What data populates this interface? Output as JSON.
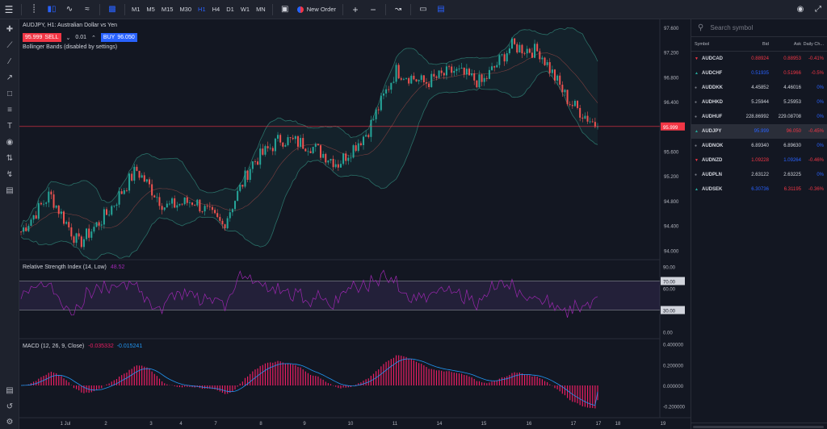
{
  "toolbar": {
    "timeframes": [
      "M1",
      "M5",
      "M15",
      "M30",
      "H1",
      "H4",
      "D1",
      "W1",
      "MN"
    ],
    "active_timeframe": "H1",
    "new_order": "New Order"
  },
  "chart": {
    "symbol_title": "AUDJPY, H1: Australian Dollar vs Yen",
    "sell_price": "95.999",
    "sell_label": "SELL",
    "quantity": "0.01",
    "buy_label": "BUY",
    "buy_price": "96.050",
    "bb_legend": "Bollinger Bands (disabled by settings)",
    "rsi_legend": "Relative Strength Index (14, Low)",
    "rsi_value": "48.52",
    "macd_legend": "MACD (12, 26, 9, Close)",
    "macd_value1": "-0.035332",
    "macd_value2": "-0.015241",
    "current_price_label": "95.999",
    "price_axis": [
      "97.600",
      "97.200",
      "96.800",
      "96.400",
      "96.000",
      "95.600",
      "95.200",
      "94.800",
      "94.400",
      "94.000"
    ],
    "rsi_axis": [
      "90.00",
      "70.00",
      "60.00",
      "30.00",
      "0.00"
    ],
    "macd_axis": [
      "0.400000",
      "0.200000",
      "0.000000",
      "-0.200000"
    ],
    "date_axis": [
      "1 Jul",
      "2",
      "3",
      "4",
      "7",
      "8",
      "9",
      "10",
      "11",
      "14",
      "15",
      "16",
      "17",
      "17",
      "18",
      "19"
    ],
    "colors": {
      "up": "#26a69a",
      "down": "#ef5350",
      "rsi": "#9c27b0",
      "macd_hist": "#e91e63",
      "macd_line": "#2196f3",
      "price_line": "#f23645"
    }
  },
  "chart_data": {
    "type": "candlestick",
    "title": "AUDJPY, H1: Australian Dollar vs Yen",
    "ylim": [
      93.9,
      97.65
    ],
    "x_dates": [
      "1 Jul",
      "2",
      "3",
      "4",
      "7",
      "8",
      "9",
      "10",
      "11",
      "14",
      "15",
      "16",
      "17",
      "17"
    ],
    "close_path_points": [
      {
        "date": "1 Jul",
        "value": 94.3
      },
      {
        "date": "1 Jul",
        "value": 94.9
      },
      {
        "date": "2",
        "value": 94.1
      },
      {
        "date": "3",
        "value": 94.6
      },
      {
        "date": "4",
        "value": 95.3
      },
      {
        "date": "4",
        "value": 94.7
      },
      {
        "date": "7",
        "value": 94.8
      },
      {
        "date": "7",
        "value": 94.4
      },
      {
        "date": "8",
        "value": 95.4
      },
      {
        "date": "8",
        "value": 95.8
      },
      {
        "date": "9",
        "value": 95.7
      },
      {
        "date": "10",
        "value": 95.4
      },
      {
        "date": "10",
        "value": 95.9
      },
      {
        "date": "11",
        "value": 96.9
      },
      {
        "date": "11",
        "value": 96.7
      },
      {
        "date": "14",
        "value": 96.9
      },
      {
        "date": "15",
        "value": 96.7
      },
      {
        "date": "15",
        "value": 97.3
      },
      {
        "date": "16",
        "value": 97.2
      },
      {
        "date": "16",
        "value": 96.4
      },
      {
        "date": "17",
        "value": 96.0
      }
    ],
    "last_price": 95.999,
    "rsi": {
      "levels": [
        70,
        30
      ],
      "last": 48.52
    },
    "macd": {
      "last_macd": -0.035332,
      "last_signal": -0.015241
    }
  },
  "watchlist": {
    "search_placeholder": "Search symbol",
    "headers": [
      "Symbol",
      "Bid",
      "Ask",
      "Daily Ch..."
    ],
    "rows": [
      {
        "symbol": "AUDCAD",
        "bid": "0.88924",
        "ask": "0.88953",
        "change": "-0.41%",
        "marker": "down"
      },
      {
        "symbol": "AUDCHF",
        "bid": "0.51935",
        "ask": "0.51966",
        "change": "-0.5%",
        "marker": "up"
      },
      {
        "symbol": "AUDDKK",
        "bid": "4.45852",
        "ask": "4.46016",
        "change": "0%",
        "marker": "dot"
      },
      {
        "symbol": "AUDHKD",
        "bid": "5.25944",
        "ask": "5.25953",
        "change": "0%",
        "marker": "dot"
      },
      {
        "symbol": "AUDHUF",
        "bid": "228.86992",
        "ask": "229.08708",
        "change": "0%",
        "marker": "dot"
      },
      {
        "symbol": "AUDJPY",
        "bid": "95.999",
        "ask": "96.050",
        "change": "-0.45%",
        "marker": "up"
      },
      {
        "symbol": "AUDNOK",
        "bid": "6.89340",
        "ask": "6.89630",
        "change": "0%",
        "marker": "dot"
      },
      {
        "symbol": "AUDNZD",
        "bid": "1.09228",
        "ask": "1.09264",
        "change": "-0.46%",
        "marker": "down"
      },
      {
        "symbol": "AUDPLN",
        "bid": "2.63122",
        "ask": "2.63225",
        "change": "0%",
        "marker": "dot"
      },
      {
        "symbol": "AUDSEK",
        "bid": "6.30736",
        "ask": "6.31195",
        "change": "-0.36%",
        "marker": "up"
      }
    ]
  }
}
